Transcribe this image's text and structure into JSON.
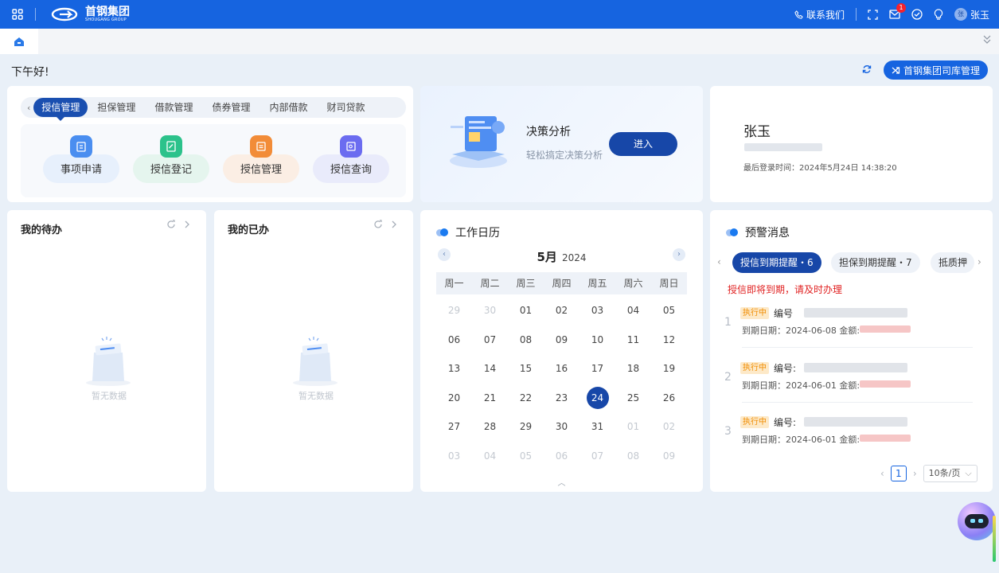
{
  "header": {
    "logo_name": "首钢集团",
    "logo_sub": "SHOUGANG GROUP",
    "contact": "联系我们",
    "mail_badge": "1",
    "user_avatar": "张",
    "user_name": "张玉"
  },
  "greeting": "下午好!",
  "switch_button": "首钢集团司库管理",
  "module_tabs": [
    "授信管理",
    "担保管理",
    "借款管理",
    "债券管理",
    "内部借款",
    "财司贷款"
  ],
  "quick_actions": [
    {
      "label": "事项申请",
      "icon": "clipboard-icon",
      "color": "#4a8ef0"
    },
    {
      "label": "授信登记",
      "icon": "edit-doc-icon",
      "color": "#2cc28b"
    },
    {
      "label": "授信管理",
      "icon": "list-doc-icon",
      "color": "#f28c38"
    },
    {
      "label": "授信查询",
      "icon": "search-doc-icon",
      "color": "#6b6cf0"
    }
  ],
  "decision": {
    "title": "决策分析",
    "subtitle": "轻松搞定决策分析",
    "button": "进入"
  },
  "user_card": {
    "name": "张玉",
    "last_login": "最后登录时间：2024年5月24日 14:38:20"
  },
  "todo": {
    "title": "我的待办",
    "empty": "暂无数据"
  },
  "done": {
    "title": "我的已办",
    "empty": "暂无数据"
  },
  "calendar": {
    "title": "工作日历",
    "month": "5月",
    "year": "2024",
    "weekdays": [
      "周一",
      "周二",
      "周三",
      "周四",
      "周五",
      "周六",
      "周日"
    ],
    "days": [
      {
        "d": "29",
        "m": true
      },
      {
        "d": "30",
        "m": true
      },
      {
        "d": "01"
      },
      {
        "d": "02"
      },
      {
        "d": "03"
      },
      {
        "d": "04"
      },
      {
        "d": "05"
      },
      {
        "d": "06"
      },
      {
        "d": "07"
      },
      {
        "d": "08"
      },
      {
        "d": "09"
      },
      {
        "d": "10"
      },
      {
        "d": "11"
      },
      {
        "d": "12"
      },
      {
        "d": "13"
      },
      {
        "d": "14"
      },
      {
        "d": "15"
      },
      {
        "d": "16"
      },
      {
        "d": "17"
      },
      {
        "d": "18"
      },
      {
        "d": "19"
      },
      {
        "d": "20"
      },
      {
        "d": "21"
      },
      {
        "d": "22"
      },
      {
        "d": "23"
      },
      {
        "d": "24",
        "t": true
      },
      {
        "d": "25"
      },
      {
        "d": "26"
      },
      {
        "d": "27"
      },
      {
        "d": "28"
      },
      {
        "d": "29"
      },
      {
        "d": "30"
      },
      {
        "d": "31"
      },
      {
        "d": "01",
        "m": true
      },
      {
        "d": "02",
        "m": true
      },
      {
        "d": "03",
        "m": true
      },
      {
        "d": "04",
        "m": true
      },
      {
        "d": "05",
        "m": true
      },
      {
        "d": "06",
        "m": true
      },
      {
        "d": "07",
        "m": true
      },
      {
        "d": "08",
        "m": true
      },
      {
        "d": "09",
        "m": true
      }
    ]
  },
  "warnings": {
    "title": "预警消息",
    "tabs": [
      "授信到期提醒・6",
      "担保到期提醒・7",
      "抵质押"
    ],
    "alert": "授信即将到期，请及时办理",
    "items": [
      {
        "num": "1",
        "status": "执行中",
        "no_label": "编号",
        "date": "到期日期：2024-06-08 金额:"
      },
      {
        "num": "2",
        "status": "执行中",
        "no_label": "编号:",
        "date": "到期日期：2024-06-01 金额:"
      },
      {
        "num": "3",
        "status": "执行中",
        "no_label": "编号:",
        "date": "到期日期：2024-06-01 金额:"
      }
    ],
    "page": "1",
    "page_size": "10条/页"
  }
}
